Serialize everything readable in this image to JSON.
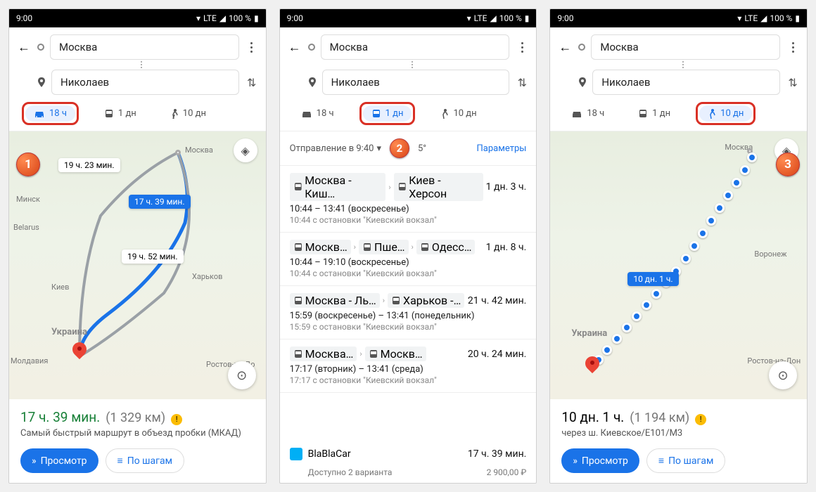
{
  "status": {
    "time": "9:00",
    "net": "LTE",
    "batt": "100 %"
  },
  "search": {
    "from": "Москва",
    "to": "Николаев"
  },
  "modes": {
    "car": "18 ч",
    "transit": "1 дн",
    "walk": "10 дн"
  },
  "panel1": {
    "alt1": "19 ч. 23 мин.",
    "main": "17 ч. 39 мин.",
    "alt2": "19 ч. 52 мин.",
    "summary_time": "17 ч. 39 мин.",
    "summary_dist": "(1 329 км)",
    "summary_desc": "Самый быстрый маршрут в объезд пробки (МКАД)",
    "btn_go": "Просмотр",
    "btn_steps": "По шагам",
    "places": {
      "moscow": "Москва",
      "kyiv": "Киев",
      "ukraine": "Украина",
      "minsk": "Минск",
      "belarus": "Belarus",
      "kharkiv": "Харьков",
      "moldova": "Молдавия",
      "rostov": "Ростов-на-До"
    }
  },
  "panel2": {
    "depart": "Отправление в 9:40",
    "temp": "5°",
    "params": "Параметры",
    "items": [
      {
        "legs": [
          "Москва - Киш…",
          "Киев - Херсон"
        ],
        "dur": "1 дн. 3 ч.",
        "det": "10:44 – 13:41 (воскресенье)",
        "sub": "10:44 с остановки \"Киевский вокзал\""
      },
      {
        "legs": [
          "Москв…",
          "Пше…",
          "Одесс…"
        ],
        "dur": "1 дн. 8 ч.",
        "det": "10:44 – 19:10 (воскресенье)",
        "sub": "10:44 с остановки \"Киевский вокзал\""
      },
      {
        "legs": [
          "Москва - Ль…",
          "Харьков -…"
        ],
        "dur": "21 ч. 42 мин.",
        "det": "15:59 (воскресенье) – 13:41 (понедельник)",
        "sub": "15:59 с остановки \"Киевский вокзал\""
      },
      {
        "legs": [
          "Москва…",
          "Москв…"
        ],
        "dur": "20 ч. 24 мин.",
        "det": "17:17 (вторник) – 13:41 (среда)",
        "sub": "17:17 с остановки \"Киевский вокзал\""
      }
    ],
    "bbc": {
      "name": "BlaBlaCar",
      "dur": "17 ч. 39 мин.",
      "avail": "Доступно 2 варианта",
      "price": "2 900,00 ₽"
    }
  },
  "panel3": {
    "badge": "10 дн. 1 ч.",
    "summary_time": "10 дн. 1 ч.",
    "summary_dist": "(1 194 км)",
    "summary_desc": "через ш. Киевское/Е101/М3",
    "btn_go": "Просмотр",
    "btn_steps": "По шагам",
    "places": {
      "moscow": "Москва",
      "ukraine": "Украина",
      "voronezh": "Воронеж",
      "rostov": "Ростов-на-Дон"
    }
  }
}
